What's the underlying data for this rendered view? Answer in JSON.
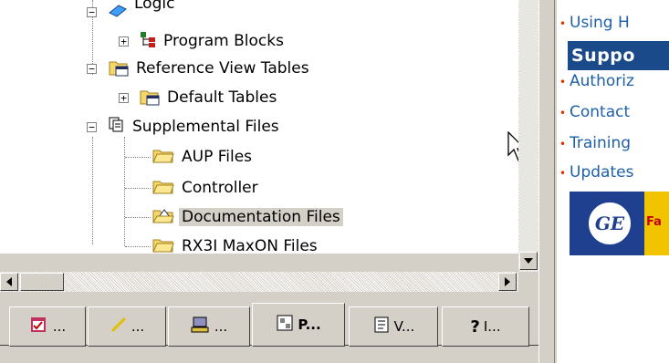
{
  "tree": {
    "items": [
      {
        "label": "Logic"
      },
      {
        "label": "Program Blocks"
      },
      {
        "label": "Reference View Tables"
      },
      {
        "label": "Default Tables"
      },
      {
        "label": "Supplemental Files"
      },
      {
        "label": "AUP Files"
      },
      {
        "label": "Controller"
      },
      {
        "label": "Documentation Files"
      },
      {
        "label": "RX3I MaxON Files"
      }
    ]
  },
  "tabs": [
    {
      "label": "..."
    },
    {
      "label": "..."
    },
    {
      "label": "..."
    },
    {
      "label": "P..."
    },
    {
      "label": "V..."
    },
    {
      "label": "I..."
    }
  ],
  "right_panel": {
    "links": [
      "Using H",
      "Authoriz",
      "Contact",
      "Training",
      "Updates"
    ],
    "support_heading": "Suppo",
    "logo_text": "GE",
    "logo_side_text": "Fa"
  },
  "colors": {
    "link": "#1f5fa8",
    "bullet": "#e03000",
    "support_bg": "#1a4a8a"
  }
}
